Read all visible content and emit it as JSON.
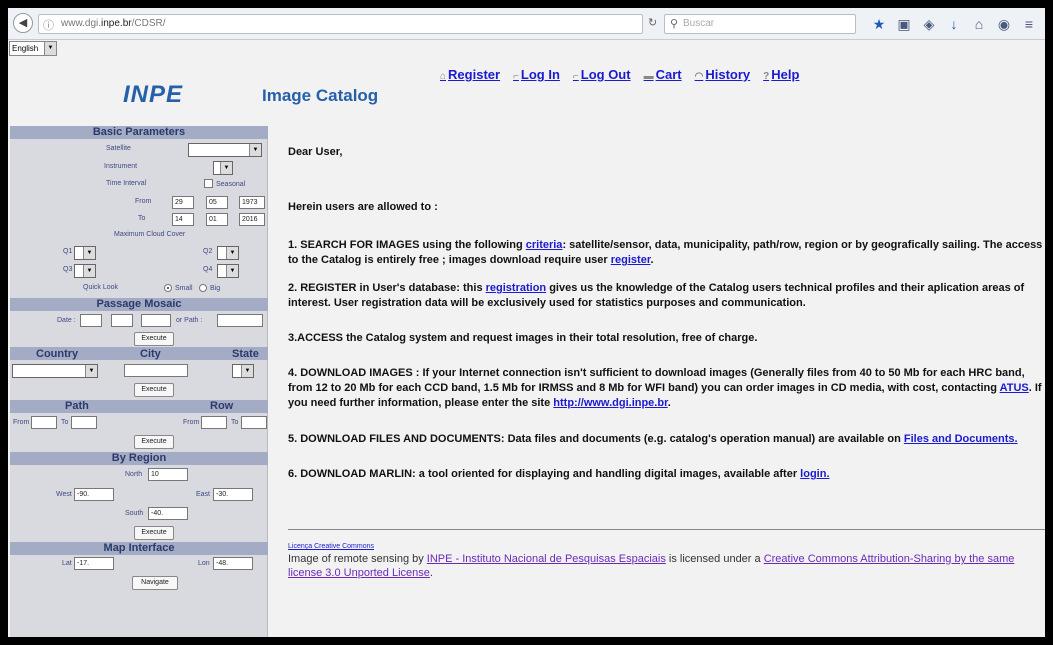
{
  "browser": {
    "url_prefix": "www.dgi.",
    "url_host": "inpe.br",
    "url_path": "/CDSR/",
    "search_placeholder": "Buscar"
  },
  "header": {
    "language": "English",
    "logo": "INPE",
    "title": "Image Catalog",
    "nav": [
      {
        "label": "Register"
      },
      {
        "label": "Log In"
      },
      {
        "label": "Log Out"
      },
      {
        "label": "Cart"
      },
      {
        "label": "History"
      },
      {
        "label": "Help"
      }
    ]
  },
  "sidebar": {
    "basic": {
      "heading": "Basic Parameters",
      "satellite": "Satellite",
      "instrument": "Instrument",
      "time_interval": "Time Interval",
      "seasonal": "Seasonal",
      "from": "From",
      "to": "To",
      "from_day": "29",
      "from_month": "05",
      "from_year": "1973",
      "to_day": "14",
      "to_month": "01",
      "to_year": "2016",
      "cloud": "Maximum Cloud Cover",
      "q1": "Q1",
      "q2": "Q2",
      "q3": "Q3",
      "q4": "Q4",
      "quicklook": "Quick Look",
      "small": "Small",
      "big": "Big"
    },
    "mosaic": {
      "heading": "Passage Mosaic",
      "date": "Date :",
      "or_path": "or  Path :",
      "execute": "Execute"
    },
    "location": {
      "country": "Country",
      "city": "City",
      "state": "State",
      "execute": "Execute"
    },
    "pathrow": {
      "path": "Path",
      "row": "Row",
      "from": "From",
      "to": "To",
      "execute": "Execute"
    },
    "region": {
      "heading": "By Region",
      "north": "North",
      "north_val": "10",
      "west": "West",
      "west_val": "-90.",
      "east": "East",
      "east_val": "-30.",
      "south": "South",
      "south_val": "-40.",
      "execute": "Execute"
    },
    "map": {
      "heading": "Map Interface",
      "lat": "Lat",
      "lat_val": "-17.",
      "lon": "Lon",
      "lon_val": "-48.",
      "navigate": "Navigate"
    }
  },
  "main": {
    "greeting": "Dear User,",
    "intro": "Herein users are allowed to :",
    "item1_a": "1. SEARCH FOR IMAGES using the following ",
    "item1_link1": "criteria",
    "item1_b": ": satellite/sensor, data, municipality, path/row, region or by geografically sailing. The access to the Catalog is entirely free ; images download require user ",
    "item1_link2": "register",
    "item1_c": ".",
    "item2_a": "2. REGISTER in User's database: this ",
    "item2_link": "registration",
    "item2_b": " gives us the knowledge of the Catalog users technical profiles and their aplication areas of interest. User registration data will be exclusively used for statistics purposes and communication.",
    "item3": "3.ACCESS the Catalog system and request images in their total resolution, free of charge.",
    "item4_a": "4. DOWNLOAD IMAGES : If your Internet connection isn't sufficient to download images (Generally files from 40 to 50 Mb for each HRC band, from 12 to 20 Mb for each CCD band, 1.5 Mb for IRMSS and 8 Mb for WFI band) you can order images in CD media, with cost, contacting ",
    "item4_link1": "ATUS",
    "item4_b": ". If you need further information, please enter the site ",
    "item4_link2": "http://www.dgi.inpe.br",
    "item4_c": ".",
    "item5_a": "5. DOWNLOAD FILES AND DOCUMENTS: Data files and documents (e.g. catalog's operation manual) are available on ",
    "item5_link": "Files and Documents.",
    "item6_a": "6. DOWNLOAD MARLIN: a tool oriented for displaying and handling digital images, available after ",
    "item6_link": "login.",
    "license_small": "Licença Creative Commons",
    "license_a": "Image of remote sensing by ",
    "license_link1": "INPE - Instituto Nacional de Pesquisas Espaciais",
    "license_b": " is licensed under a ",
    "license_link2": "Creative Commons Attribution-Sharing by the same license 3.0 Unported License",
    "license_c": "."
  }
}
